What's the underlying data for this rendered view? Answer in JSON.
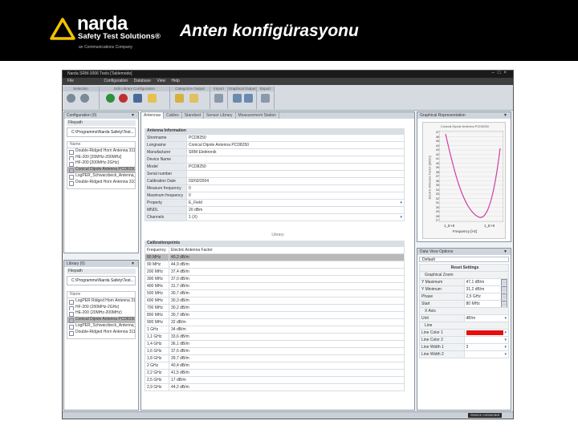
{
  "slide": {
    "logo_name": "narda",
    "logo_sub": "Safety Test Solutions®",
    "logo_sub2": "an Communications Company",
    "title": "Anten konfigürasyonu"
  },
  "app": {
    "window_title": "Narda SRM-3006 Tools [Tablemode]",
    "menu": [
      "File",
      "Configuration",
      "Database",
      "View",
      "Help"
    ],
    "ribbon_groups": [
      "Selection",
      "Edit Library Configuration",
      "Categorize Output",
      "Import",
      "Graphical Output",
      "Export"
    ],
    "left_top": {
      "title": "Configuration (0)",
      "filepath_label": "Filepath",
      "path": "C:\\Programme\\Narda Safety\\Test...",
      "header": "Name",
      "items": [
        "Double-Ridged Horn Antenna 3115",
        "HE-200 [20MHz-200MHz]",
        "HF-200 [200MHz-2GHz]",
        "Conical Dipole Antenna PCD8250",
        "LogPER_Schwarzbeck_Antenna_UHL...",
        "Double-Ridged Horn Antenna 3106"
      ]
    },
    "left_bottom": {
      "title": "Library (0)",
      "filepath_label": "Filepath",
      "path": "C:\\Programme\\Narda Safety\\Test...",
      "header": "Name",
      "items": [
        "LogPER Ridged Horn Antenna 3106",
        "HF-200 (200MHz-2GHz)",
        "HE-200 (20MHz-200MHz)",
        "Conical Dipole Antenna PCD8250",
        "LogPER_Schwarzbeck_Antenna_UHL...",
        "Double-Ridged Horn Antenna 3115"
      ]
    },
    "center": {
      "tabs": [
        "Antennas",
        "Cables",
        "Standard",
        "Sensor Library",
        "Measurement Station"
      ],
      "info_title": "Antenna Information",
      "info_rows": [
        {
          "k": "Shortname",
          "v": "PCD8250"
        },
        {
          "k": "Longname",
          "v": "Conical Dipole Antenna PCD8250"
        },
        {
          "k": "Manufacturer",
          "v": "SRM Elektronik"
        },
        {
          "k": "Device Name",
          "v": ""
        },
        {
          "k": "Model",
          "v": "PCD8250"
        },
        {
          "k": "Serial number",
          "v": ""
        },
        {
          "k": "Calibration Date",
          "v": "03/03/2004"
        },
        {
          "k": "Measure frequency",
          "v": "0"
        },
        {
          "k": "Maximum frequency",
          "v": "0"
        },
        {
          "k": "Property",
          "v": "E_Field"
        },
        {
          "k": "MNDL",
          "v": "20 dBm"
        },
        {
          "k": "Channels",
          "v": "1 (X)"
        }
      ],
      "library_label": "Library",
      "cal_title": "Calibrationpoints",
      "cal_header": [
        "Frequency",
        "Electric Antenna Factor"
      ],
      "cal_rows": [
        [
          "80 MHz",
          "40,2 dB/m"
        ],
        [
          "90 MHz",
          "44,9 dB/m"
        ],
        [
          "200 MHz",
          "37,4 dB/m"
        ],
        [
          "300 MHz",
          "37,0 dB/m"
        ],
        [
          "400 MHz",
          "31,7 dB/m"
        ],
        [
          "500 MHz",
          "30,7 dB/m"
        ],
        [
          "600 MHz",
          "30,3 dB/m"
        ],
        [
          "700 MHz",
          "30,2 dB/m"
        ],
        [
          "800 MHz",
          "30,7 dB/m"
        ],
        [
          "900 MHz",
          "32 dB/m"
        ],
        [
          "1 GHz",
          "34 dB/m"
        ],
        [
          "1,1 GHz",
          "33,6 dB/m"
        ],
        [
          "1,4 GHz",
          "36,1 dB/m"
        ],
        [
          "1,6 GHz",
          "37,6 dB/m"
        ],
        [
          "1,8 GHz",
          "39,7 dB/m"
        ],
        [
          "2 GHz",
          "40,4 dB/m"
        ],
        [
          "2,2 GHz",
          "41,5 dB/m"
        ],
        [
          "2,5 GHz",
          "17 dB/m"
        ],
        [
          "2,9 GHz",
          "44,2 dB/m"
        ]
      ]
    },
    "graph": {
      "title": "Graphical Representation",
      "chart_title": "Conical Dipole Antenna PCD8250",
      "ylabel": "Electric Antenna Factor [dB/m]",
      "xlabel": "Frequency [Hz]",
      "xticks": [
        "1_E+8",
        "1_E+9"
      ],
      "yticks": [
        "47",
        "46",
        "45",
        "44",
        "43",
        "42",
        "41",
        "40",
        "39",
        "38",
        "37",
        "36",
        "35",
        "34",
        "33",
        "32",
        "31",
        "30",
        "29",
        "28",
        "27"
      ]
    },
    "view_options": {
      "title": "Data View Options",
      "default_label": "Default",
      "reset_label": "Reset Settings",
      "group_zoom": "Graphical Zoom",
      "rows_zoom": [
        {
          "k": "Y Maximum",
          "v": "47,1 dB/m"
        },
        {
          "k": "Y Minimum",
          "v": "31,2 dB/m"
        },
        {
          "k": "Phase",
          "v": "2,5 GHz"
        },
        {
          "k": "Start",
          "v": "80 MHz"
        }
      ],
      "group_x": "X Axis",
      "rows_x": [
        {
          "k": "Unit",
          "v": "dB/m"
        }
      ],
      "group_line": "Line",
      "rows_line": [
        {
          "k": "Line Color 1",
          "v": ""
        },
        {
          "k": "Line Color 2",
          "v": ""
        },
        {
          "k": "Line Width 1",
          "v": "3"
        },
        {
          "k": "Line Width 2",
          "v": ""
        }
      ]
    },
    "status": {
      "device_button": "Device connected"
    }
  },
  "colors": {
    "accent": "#e41010",
    "plot": "#d040a0"
  }
}
